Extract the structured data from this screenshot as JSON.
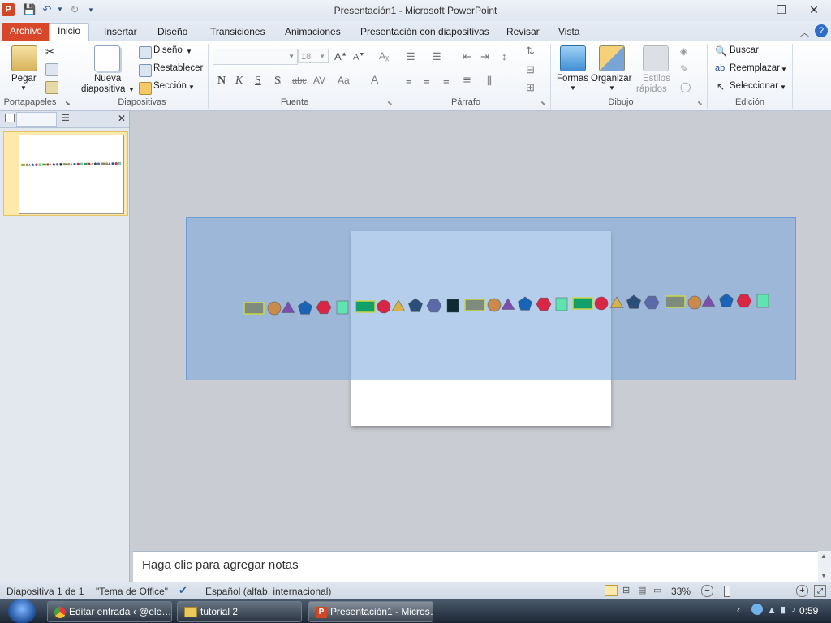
{
  "window": {
    "title": "Presentación1  -  Microsoft PowerPoint"
  },
  "tabs": [
    "Archivo",
    "Inicio",
    "Insertar",
    "Diseño",
    "Transiciones",
    "Animaciones",
    "Presentación con diapositivas",
    "Revisar",
    "Vista"
  ],
  "ribbon": {
    "portapapeles": {
      "label": "Portapapeles",
      "pegar": "Pegar"
    },
    "diapositivas": {
      "label": "Diapositivas",
      "nueva": "Nueva",
      "diapositiva": "diapositiva",
      "diseno": "Diseño",
      "restablecer": "Restablecer",
      "seccion": "Sección"
    },
    "fuente": {
      "label": "Fuente",
      "font_name": "",
      "font_size": "18"
    },
    "parrafo": {
      "label": "Párrafo"
    },
    "dibujo": {
      "label": "Dibujo",
      "formas": "Formas",
      "organizar": "Organizar",
      "estilos": "Estilos",
      "rapidos": "rápidos"
    },
    "edicion": {
      "label": "Edición",
      "buscar": "Buscar",
      "reemplazar": "Reemplazar",
      "seleccionar": "Seleccionar"
    }
  },
  "slides_pane": {
    "slide_number": "1"
  },
  "notes": {
    "placeholder": "Haga clic para agregar notas"
  },
  "status": {
    "slide": "Diapositiva 1 de 1",
    "theme": "\"Tema de Office\"",
    "language": "Español (alfab. internacional)",
    "zoom": "33%"
  },
  "taskbar": {
    "items": [
      "Editar entrada ‹ @ele…",
      "tutorial 2",
      "Presentación1 - Micros…"
    ],
    "clock": "0:59"
  },
  "shapes": {
    "colors": {
      "gray": "#7f8c7d",
      "orange": "#c98a4b",
      "purple": "#7b4fb0",
      "blue": "#1a64b8",
      "red": "#d92645",
      "mint": "#5fe3b0",
      "green": "#12a06a",
      "gold": "#d9b24a",
      "navy": "#2a4f7a",
      "slate": "#5a6aa8",
      "black": "#0e2a33"
    }
  }
}
